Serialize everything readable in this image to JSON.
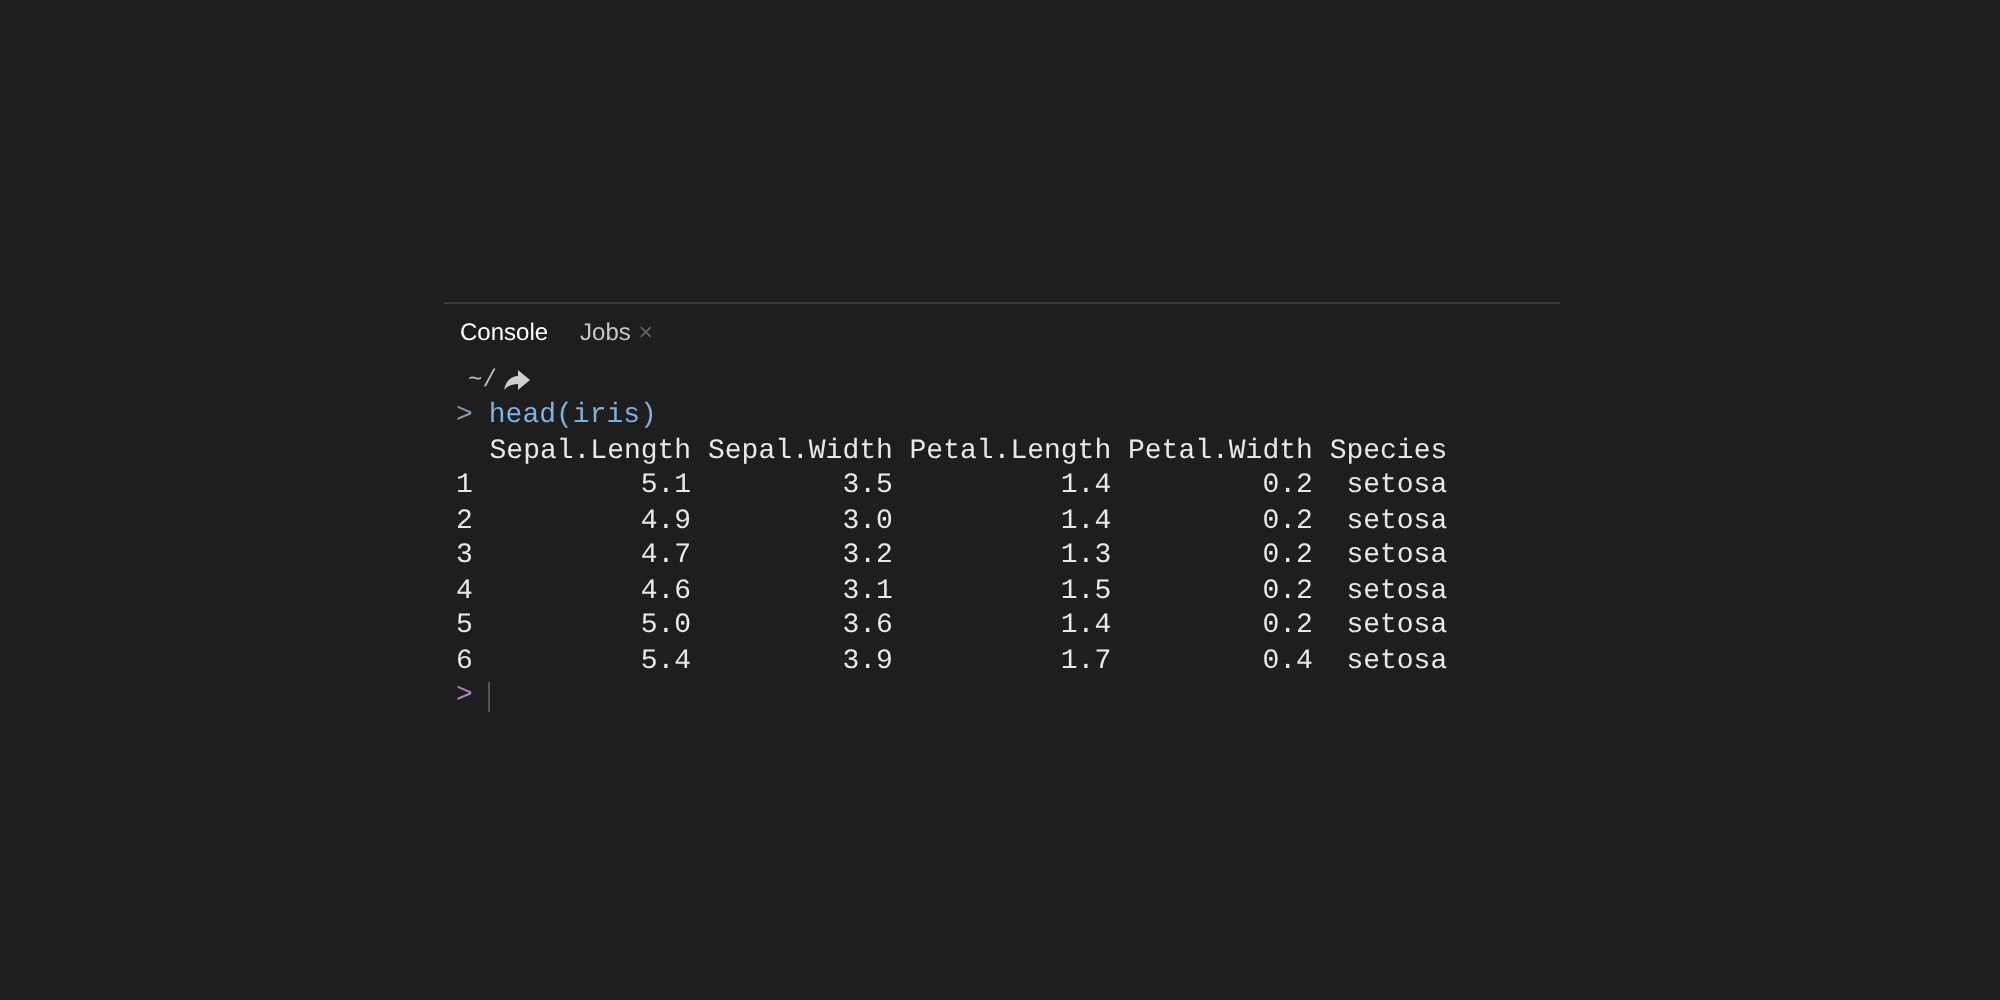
{
  "tabs": [
    {
      "label": "Console",
      "selected": true
    },
    {
      "label": "Jobs",
      "selected": false,
      "close": "×"
    }
  ],
  "path": "~/",
  "console": {
    "prompt": ">",
    "command": "head(iris)",
    "table": {
      "columns": [
        "",
        "Sepal.Length",
        "Sepal.Width",
        "Petal.Length",
        "Petal.Width",
        "Species"
      ],
      "rows": [
        [
          "1",
          "5.1",
          "3.5",
          "1.4",
          "0.2",
          "setosa"
        ],
        [
          "2",
          "4.9",
          "3.0",
          "1.4",
          "0.2",
          "setosa"
        ],
        [
          "3",
          "4.7",
          "3.2",
          "1.3",
          "0.2",
          "setosa"
        ],
        [
          "4",
          "4.6",
          "3.1",
          "1.5",
          "0.2",
          "setosa"
        ],
        [
          "5",
          "5.0",
          "3.6",
          "1.4",
          "0.2",
          "setosa"
        ],
        [
          "6",
          "5.4",
          "3.9",
          "1.7",
          "0.4",
          "setosa"
        ]
      ]
    },
    "input_prompt": ">"
  }
}
